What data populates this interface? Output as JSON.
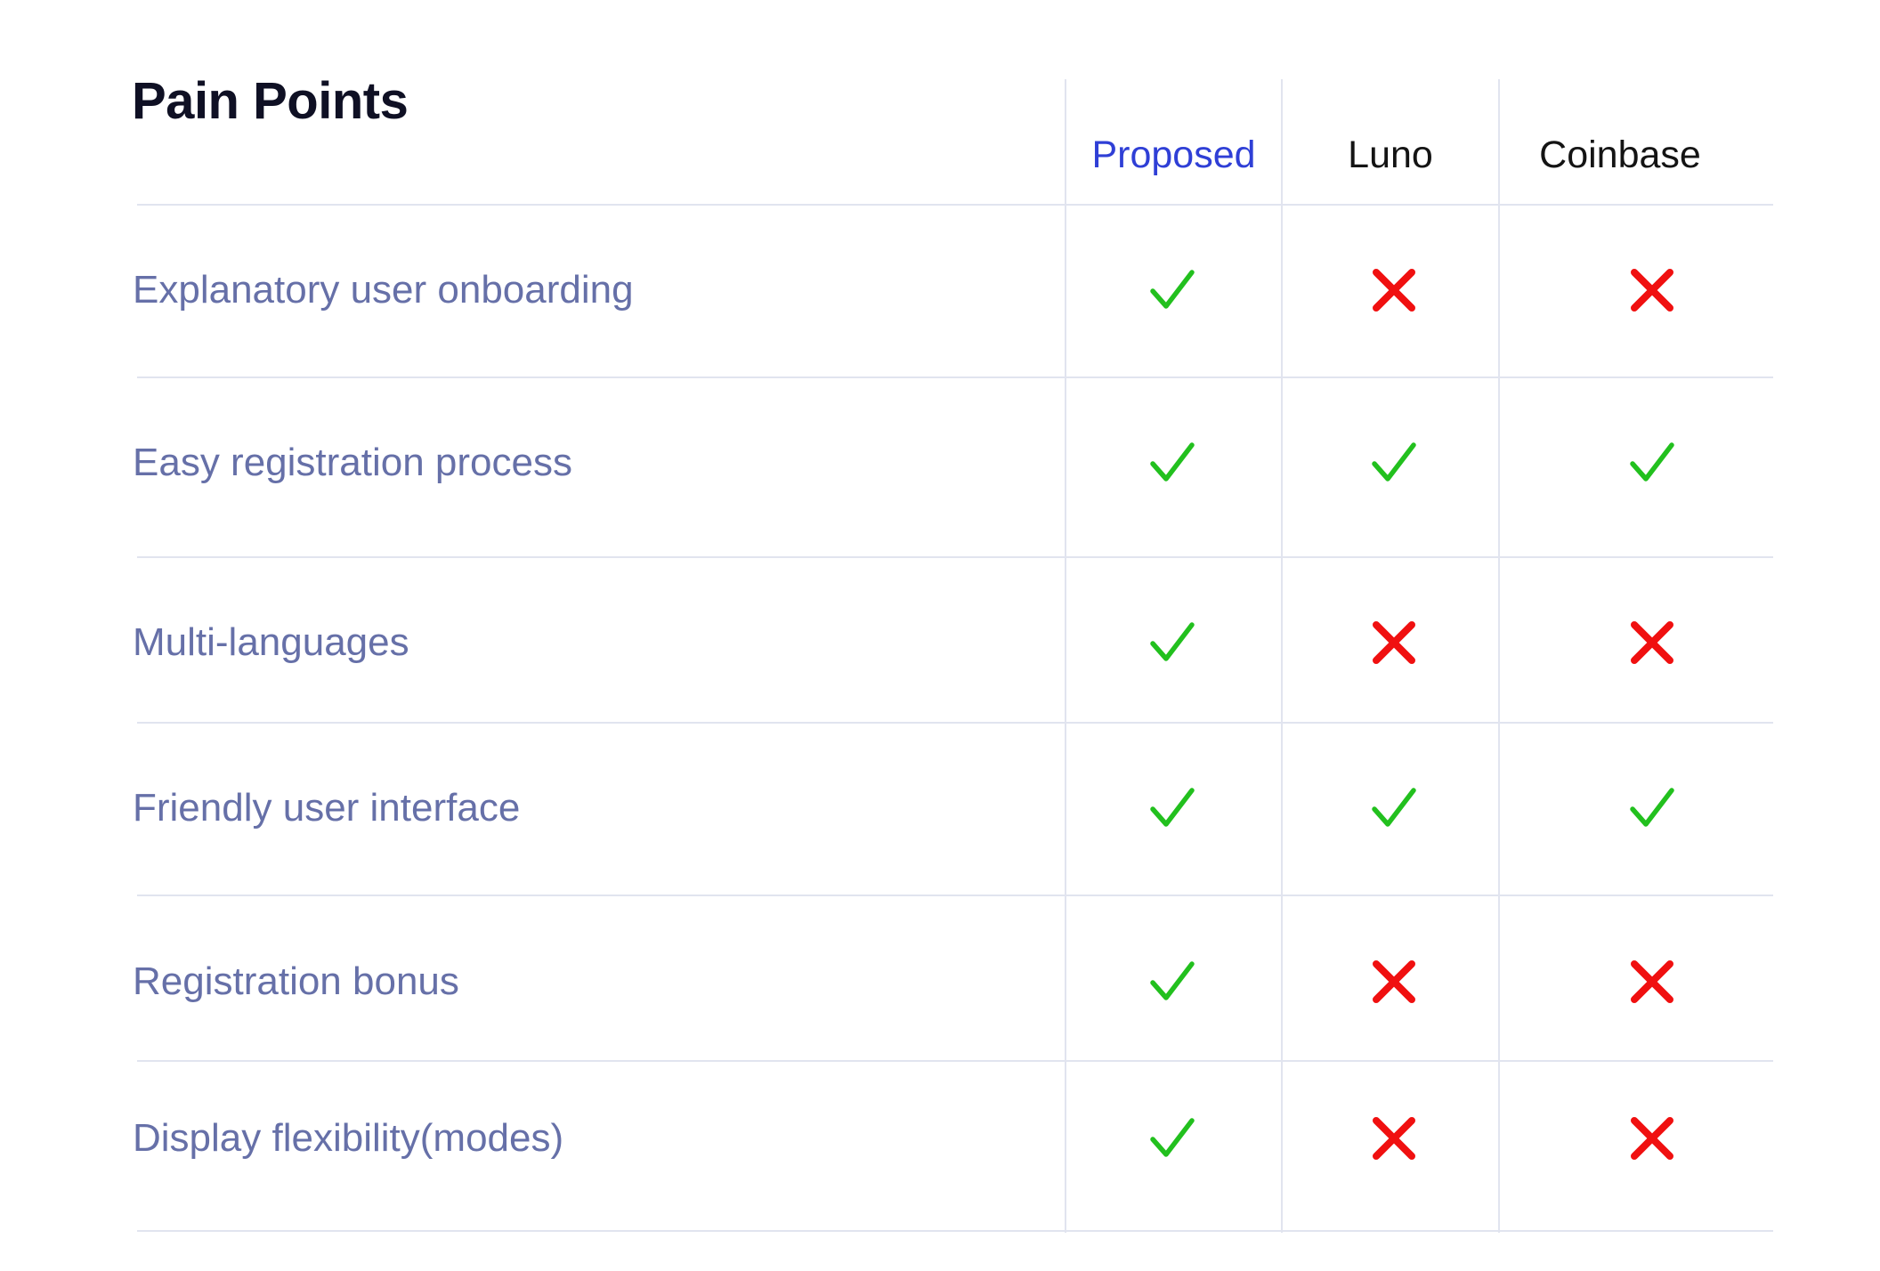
{
  "title": "Pain Points",
  "columns": [
    {
      "label": "Proposed",
      "highlight": true
    },
    {
      "label": "Luno",
      "highlight": false
    },
    {
      "label": "Coinbase",
      "highlight": false
    }
  ],
  "rows": [
    {
      "label": "Explanatory user onboarding",
      "values": [
        true,
        false,
        false
      ]
    },
    {
      "label": "Easy registration process",
      "values": [
        true,
        true,
        true
      ]
    },
    {
      "label": "Multi-languages",
      "values": [
        true,
        false,
        false
      ]
    },
    {
      "label": "Friendly user interface",
      "values": [
        true,
        true,
        true
      ]
    },
    {
      "label": "Registration bonus",
      "values": [
        true,
        false,
        false
      ]
    },
    {
      "label": "Display flexibility(modes)",
      "values": [
        true,
        false,
        false
      ]
    }
  ],
  "colors": {
    "check": "#22c01e",
    "cross": "#f01010",
    "highlight_header": "#2f3fd6",
    "row_label": "#6670a8",
    "grid": "#e1e4ef"
  },
  "icons": {
    "yes": "check-icon",
    "no": "cross-icon"
  }
}
